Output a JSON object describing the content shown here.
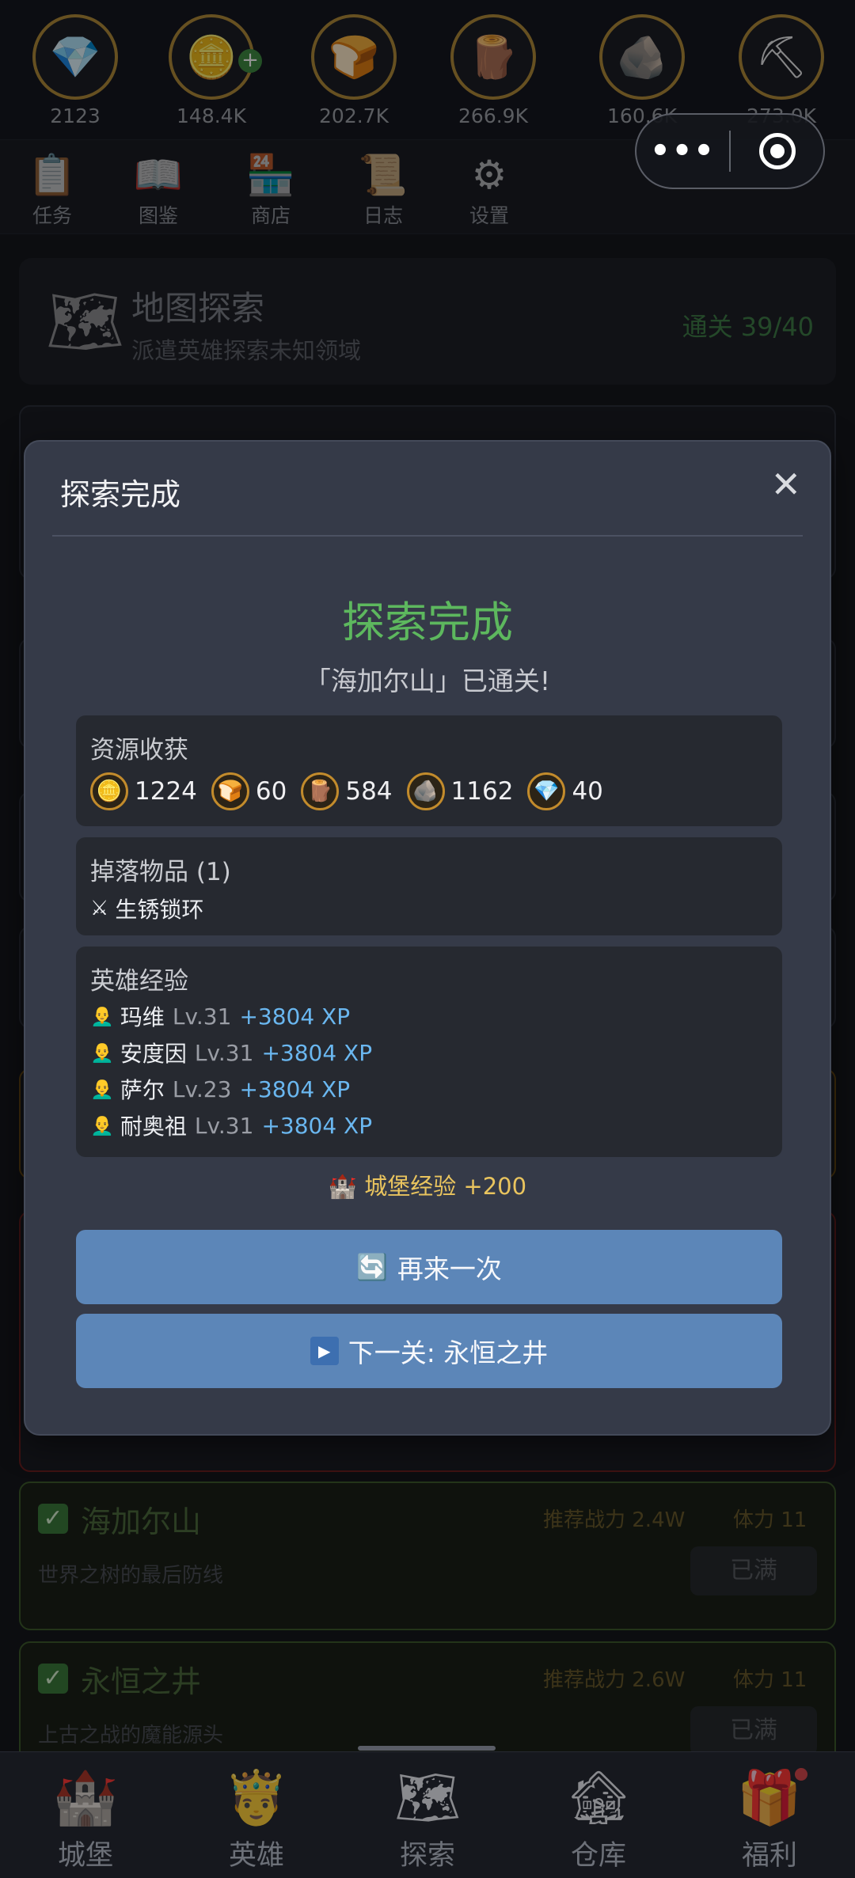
{
  "resources": [
    {
      "icon": "💎",
      "name": "gem-icon",
      "value": "2123",
      "plus": false
    },
    {
      "icon": "🪙",
      "name": "gold-coins-icon",
      "value": "148.4K",
      "plus": true
    },
    {
      "icon": "🍞",
      "name": "bread-icon",
      "value": "202.7K",
      "plus": false
    },
    {
      "icon": "🪵",
      "name": "wood-icon",
      "value": "266.9K",
      "plus": false
    },
    {
      "icon": "🪨",
      "name": "stone-icon",
      "value": "160.6K",
      "plus": false
    },
    {
      "icon": "⛏",
      "name": "ore-icon",
      "value": "273.0K",
      "plus": false
    }
  ],
  "toolbar": [
    {
      "icon": "📋",
      "name": "tasks-icon",
      "label": "任务"
    },
    {
      "icon": "📖",
      "name": "codex-icon",
      "label": "图鉴"
    },
    {
      "icon": "🏪",
      "name": "shop-icon",
      "label": "商店"
    },
    {
      "icon": "📜",
      "name": "log-icon",
      "label": "日志"
    },
    {
      "icon": "⚙",
      "name": "settings-icon",
      "label": "设置"
    }
  ],
  "header": {
    "title": "地图探索",
    "subtitle": "派遣英雄探索未知领域",
    "progress": "通关 39/40"
  },
  "levels": [
    {
      "name": "海加尔山",
      "power": "推荐战力 2.4W",
      "stamina": "体力 11",
      "desc": "世界之树的最后防线",
      "button": "已满"
    },
    {
      "name": "永恒之井",
      "power": "推荐战力 2.6W",
      "stamina": "体力 11",
      "desc": "上古之战的魔能源头",
      "button": "已满"
    }
  ],
  "modal": {
    "title": "探索完成",
    "close": "✕",
    "headline": "探索完成",
    "subline": "「海加尔山」已通关!",
    "resources_title": "资源收获",
    "resources": [
      {
        "icon": "🪙",
        "value": "1224"
      },
      {
        "icon": "🍞",
        "value": "60"
      },
      {
        "icon": "🪵",
        "value": "584"
      },
      {
        "icon": "🪨",
        "value": "1162"
      },
      {
        "icon": "💎",
        "value": "40"
      }
    ],
    "drops_title": "掉落物品 (1)",
    "drops": [
      {
        "icon": "⚔",
        "name": "生锈锁环"
      }
    ],
    "heroes_title": "英雄经验",
    "heroes": [
      {
        "name": "玛维",
        "level": "Lv.31",
        "xp": "+3804 XP"
      },
      {
        "name": "安度因",
        "level": "Lv.31",
        "xp": "+3804 XP"
      },
      {
        "name": "萨尔",
        "level": "Lv.23",
        "xp": "+3804 XP"
      },
      {
        "name": "耐奥祖",
        "level": "Lv.31",
        "xp": "+3804 XP"
      }
    ],
    "castle_xp": "城堡经验 +200",
    "retry_label": "再来一次",
    "next_label": "下一关: 永恒之井"
  },
  "bottom_nav": [
    {
      "icon": "🏰",
      "name": "castle-icon",
      "label": "城堡"
    },
    {
      "icon": "🤴",
      "name": "hero-icon",
      "label": "英雄"
    },
    {
      "icon": "🗺",
      "name": "explore-icon",
      "label": "探索"
    },
    {
      "icon": "🏚",
      "name": "warehouse-icon",
      "label": "仓库"
    },
    {
      "icon": "🎁",
      "name": "welfare-icon",
      "label": "福利"
    }
  ]
}
